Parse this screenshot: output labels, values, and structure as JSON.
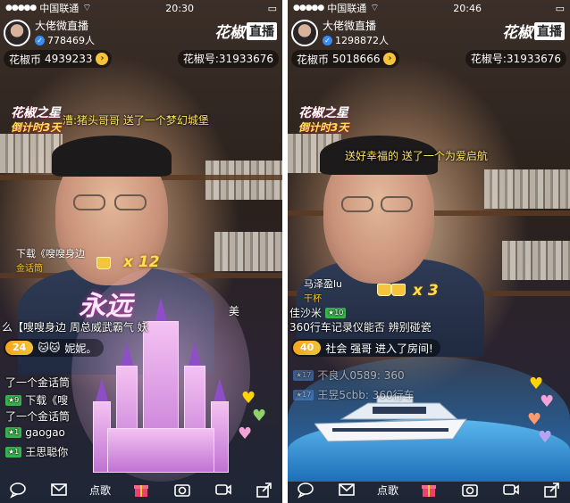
{
  "status_bar": {
    "carrier": "中国联通",
    "left_time": "20:30",
    "right_time": "20:46"
  },
  "left": {
    "host": {
      "name": "大佬微直播",
      "viewers": "778469人"
    },
    "brand": {
      "name": "花椒",
      "tag": "直播"
    },
    "coins": {
      "label": "花椒币",
      "value": "4939233"
    },
    "room_id": "花椒号:31933676",
    "event": {
      "title": "花椒之星",
      "subtitle": "倒计时3天"
    },
    "banner": "漕:猪头哥哥 送了一个梦幻城堡",
    "gift_notice": {
      "text": "下载《嗖嗖身边",
      "sub": "金话筒",
      "count": "x 12"
    },
    "castle_text": "永远",
    "scroll_line": "么【嗖嗖身边          周总威武霸气 妖",
    "scroll_name": "美",
    "entry": {
      "level": "24",
      "text": "妮妮。"
    },
    "chat": [
      {
        "text": "了一个金话筒"
      },
      {
        "badge": "9",
        "text": "下载《嗖"
      },
      {
        "text": "了一个金话筒"
      },
      {
        "badge": "1",
        "text": "gaogao"
      },
      {
        "badge": "1",
        "text": "王思聪你"
      }
    ],
    "toolbar_song": "点歌"
  },
  "right": {
    "host": {
      "name": "大佬微直播",
      "viewers": "1298872人"
    },
    "brand": {
      "name": "花椒",
      "tag": "直播"
    },
    "coins": {
      "label": "花椒币",
      "value": "5018666"
    },
    "room_id": "花椒号:31933676",
    "event": {
      "title": "花椒之星",
      "subtitle": "倒计时3天"
    },
    "banner": "送好幸福的 送了一个为爱启航",
    "gift_notice": {
      "text": "马泽盈lu",
      "sub": "干杯",
      "count": "x 3"
    },
    "scroll_line": "佳沙米",
    "scroll_badge": "10",
    "scroll_line2": "360行车记录仪能否 辨别碰瓷",
    "entry": {
      "level": "40",
      "text": "社会 强哥  进入了房间!"
    },
    "chat": [
      {
        "badge": "17",
        "text": "不良人0589: 360"
      },
      {
        "badge": "17",
        "text": "王昱5cbb: 360行车"
      }
    ],
    "toolbar_song": "点歌"
  },
  "colors": {
    "accent": "#f6c33a",
    "level": "#f8a21b",
    "chat_green": "#37b24d"
  }
}
